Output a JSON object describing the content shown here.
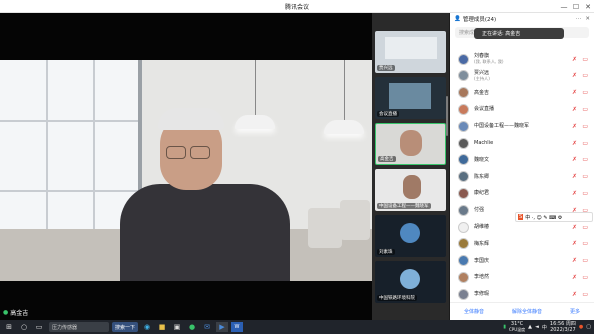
{
  "window": {
    "title": "腾讯会议",
    "minimize": "—",
    "maximize": "☐",
    "close": "✕"
  },
  "speaker": {
    "name": "高金吉"
  },
  "thumbnails": [
    {
      "label": "贾兴远"
    },
    {
      "label": "会议直播"
    },
    {
      "label": "高金吉"
    },
    {
      "label": "中国设备工程——魏晓军"
    },
    {
      "label": "刘素珠"
    },
    {
      "label": "中国铁路环境科院"
    }
  ],
  "panel": {
    "title": "管理成员(24)",
    "search_placeholder": "搜索成员",
    "tip": "正在讲话: 高金吉",
    "members": [
      {
        "name": "刘春旗",
        "role": "(我, 联系人, 我)",
        "avatar_color": "#4a6aa5"
      },
      {
        "name": "贾兴远",
        "role": "(主持人)",
        "avatar_color": "#7f8e9c"
      },
      {
        "name": "高金吉",
        "role": "",
        "avatar_color": "#a7785c"
      },
      {
        "name": "会议直播",
        "role": "",
        "avatar_color": "#c87a5c"
      },
      {
        "name": "中国设备工程——魏晓军",
        "role": "",
        "avatar_color": "#6a8ab8"
      },
      {
        "name": "Machlie",
        "role": "",
        "avatar_color": "#5a5a5a"
      },
      {
        "name": "魏晓文",
        "role": "",
        "avatar_color": "#3f6a9a"
      },
      {
        "name": "陈东卿",
        "role": "",
        "avatar_color": "#5a6f80"
      },
      {
        "name": "康纪君",
        "role": "",
        "avatar_color": "#8a5a50"
      },
      {
        "name": "付强",
        "role": "",
        "avatar_color": "#6a7a8a"
      },
      {
        "name": "胡维椿",
        "role": "",
        "avatar_color": "#f0f0f0"
      },
      {
        "name": "梅东辉",
        "role": "",
        "avatar_color": "#9a7a3a"
      },
      {
        "name": "李国庆",
        "role": "",
        "avatar_color": "#4a7ab0"
      },
      {
        "name": "李培然",
        "role": "",
        "avatar_color": "#b08060"
      },
      {
        "name": "李修瑕",
        "role": "",
        "avatar_color": "#7a8090"
      }
    ],
    "footer": [
      "全体静音",
      "解除全体静音",
      "更多"
    ]
  },
  "float_toolbar": "中 ·, ☺ ✎ ⌨ ⚙",
  "taskbar": {
    "search": "压力传感器",
    "button": "搜索一下",
    "weather": "31°C",
    "weather_note": "CPU温度",
    "time": "16:56 周四",
    "date": "2022/3/27"
  }
}
